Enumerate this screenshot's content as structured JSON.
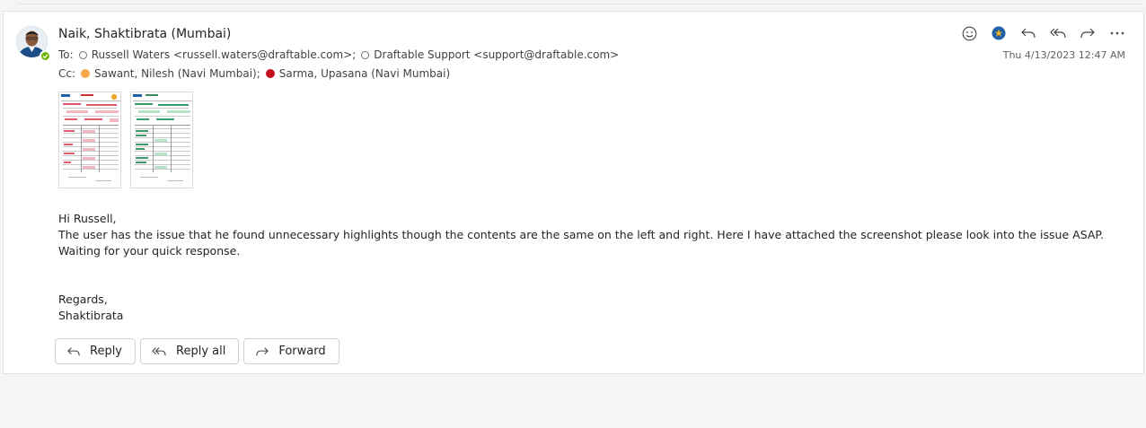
{
  "message": {
    "sender": "Naik, Shaktibrata (Mumbai)",
    "to_label": "To:",
    "to": [
      {
        "text": "Russell Waters <russell.waters@draftable.com>;"
      },
      {
        "text": "Draftable Support <support@draftable.com>"
      }
    ],
    "cc_label": "Cc:",
    "cc": [
      {
        "text": "Sawant, Nilesh (Navi Mumbai);",
        "status_color": "#f7a94a"
      },
      {
        "text": "Sarma, Upasana (Navi Mumbai)",
        "status_color": "#c50f1f"
      }
    ],
    "timestamp": "Thu 4/13/2023 12:47 AM",
    "body": {
      "greeting": "Hi Russell,",
      "paragraph": "The user has the issue that he found unnecessary highlights though the contents are the same on the left and right. Here I have attached the screenshot please look into the issue ASAP. Waiting for your quick response.",
      "closing": "Regards,",
      "signature": "Shaktibrata"
    }
  },
  "toolbar": {
    "icons": [
      "emoji-icon",
      "copilot-icon",
      "reply-icon",
      "reply-all-icon",
      "forward-icon",
      "more-icon"
    ]
  },
  "actions": {
    "reply": "Reply",
    "reply_all": "Reply all",
    "forward": "Forward"
  },
  "colors": {
    "presence": "#6bb700",
    "accent": "#0f6cbd"
  }
}
